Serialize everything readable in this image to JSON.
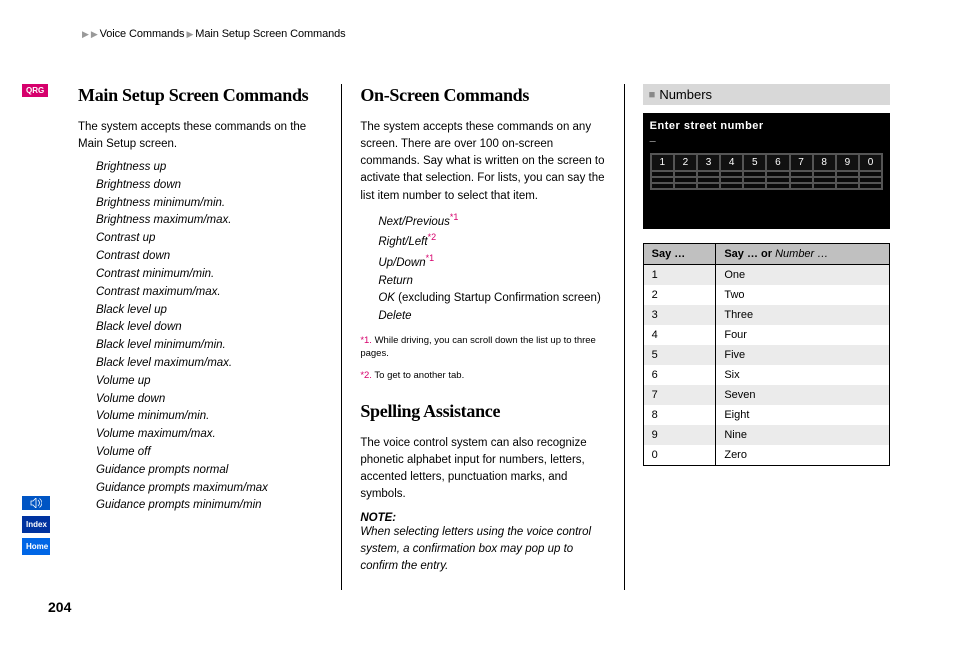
{
  "breadcrumb": {
    "level1": "Voice Commands",
    "level2": "Main Setup Screen Commands"
  },
  "side": {
    "qrg": "QRG",
    "index": "Index",
    "home": "Home"
  },
  "page_number": "204",
  "col1": {
    "title": "Main Setup Screen Commands",
    "intro": "The system accepts these commands on the Main Setup screen.",
    "commands": [
      "Brightness up",
      "Brightness down",
      "Brightness minimum/min.",
      "Brightness maximum/max.",
      "Contrast up",
      "Contrast down",
      "Contrast minimum/min.",
      "Contrast maximum/max.",
      "Black level up",
      "Black level down",
      "Black level minimum/min.",
      "Black level maximum/max.",
      "Volume up",
      "Volume down",
      "Volume minimum/min.",
      "Volume maximum/max.",
      "Volume off",
      "Guidance prompts normal",
      "Guidance prompts maximum/max",
      "Guidance prompts minimum/min"
    ]
  },
  "col2": {
    "title1": "On-Screen Commands",
    "intro1": "The system accepts these commands on any screen. There are over 100 on-screen commands. Say what is written on the screen to activate that selection. For lists, you can say the list item number to select that item.",
    "commands": [
      {
        "text": "Next/Previous",
        "fn": "*1"
      },
      {
        "text": "Right/Left",
        "fn": "*2"
      },
      {
        "text": "Up/Down",
        "fn": "*1"
      },
      {
        "text": "Return",
        "fn": ""
      },
      {
        "text": "OK",
        "suffix": " (excluding Startup Confirmation screen)",
        "fn": ""
      },
      {
        "text": "Delete",
        "fn": ""
      }
    ],
    "footnotes": [
      {
        "label": "*1.",
        "text": " While driving, you can scroll down the list up to three pages."
      },
      {
        "label": "*2.",
        "text": " To get to another tab."
      }
    ],
    "title2": "Spelling Assistance",
    "intro2": "The voice control system can also recognize phonetic alphabet input for numbers, letters, accented letters, punctuation marks, and symbols.",
    "note_label": "NOTE:",
    "note_text": "When selecting letters using the voice control system, a confirmation box may pop up to confirm the entry."
  },
  "col3": {
    "subheading": "Numbers",
    "screen_title": "Enter street number",
    "kb_numbers": [
      "1",
      "2",
      "3",
      "4",
      "5",
      "6",
      "7",
      "8",
      "9",
      "0"
    ],
    "table": {
      "header1": "Say …",
      "header2_prefix": "Say … or ",
      "header2_italic": "Number …",
      "rows": [
        {
          "a": "1",
          "b": "One"
        },
        {
          "a": "2",
          "b": "Two"
        },
        {
          "a": "3",
          "b": "Three"
        },
        {
          "a": "4",
          "b": "Four"
        },
        {
          "a": "5",
          "b": "Five"
        },
        {
          "a": "6",
          "b": "Six"
        },
        {
          "a": "7",
          "b": "Seven"
        },
        {
          "a": "8",
          "b": "Eight"
        },
        {
          "a": "9",
          "b": "Nine"
        },
        {
          "a": "0",
          "b": "Zero"
        }
      ]
    }
  }
}
